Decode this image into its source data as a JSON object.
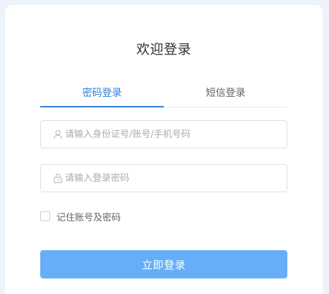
{
  "title": "欢迎登录",
  "tabs": [
    {
      "label": "密码登录",
      "active": true
    },
    {
      "label": "短信登录",
      "active": false
    }
  ],
  "account_field": {
    "placeholder": "请输入身份证号/账号/手机号码",
    "value": "",
    "icon": "user-icon"
  },
  "password_field": {
    "placeholder": "请输入登录密码",
    "value": "",
    "icon": "lock-icon"
  },
  "remember": {
    "label": "记住账号及密码",
    "checked": false
  },
  "submit_label": "立即登录",
  "colors": {
    "accent": "#2f7fd8",
    "button": "#66aef8",
    "background": "#eef3fb"
  }
}
